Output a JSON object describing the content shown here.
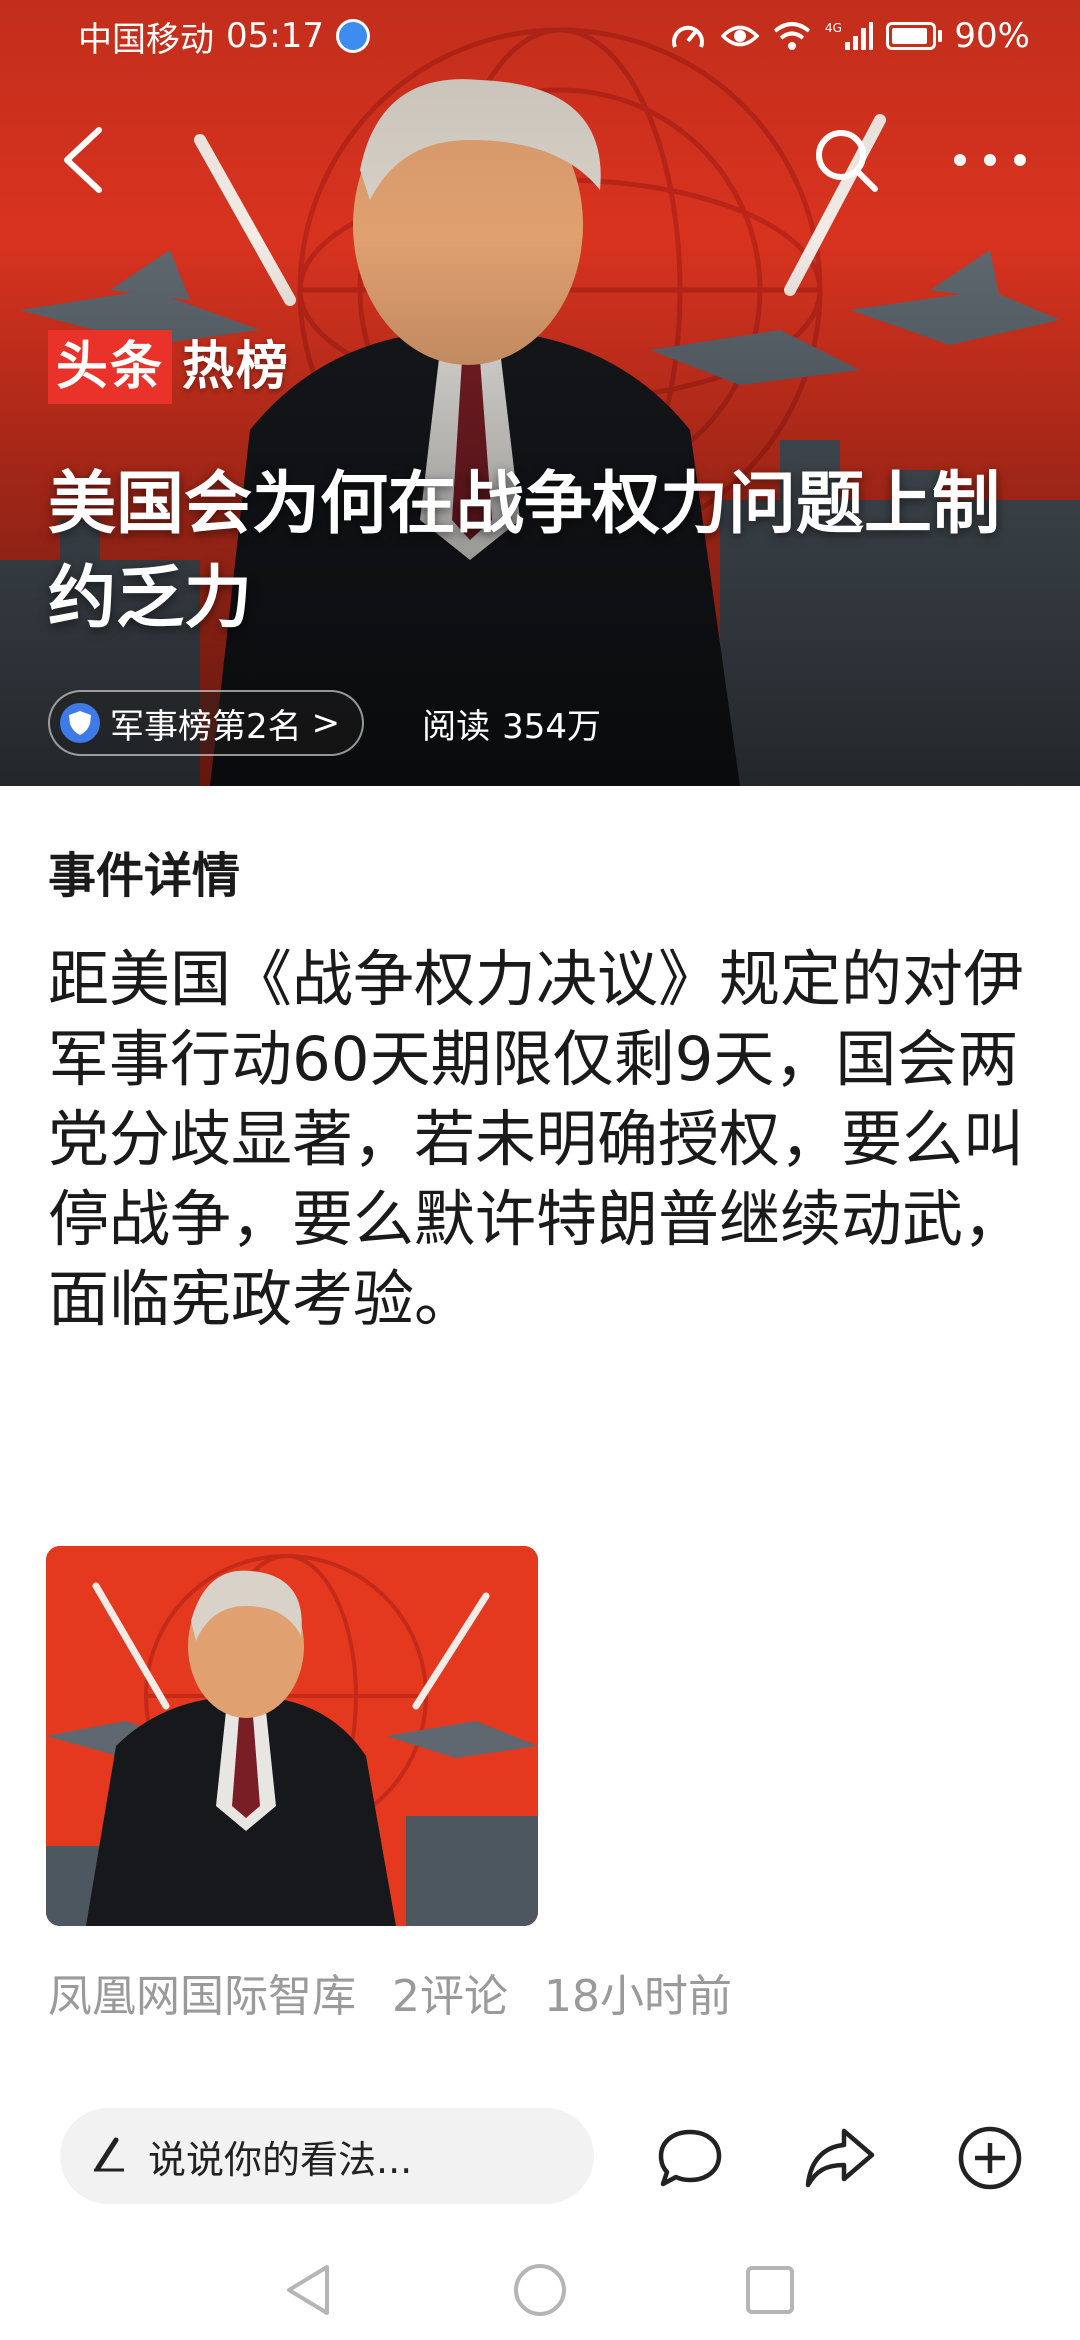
{
  "status_bar": {
    "carrier": "中国移动",
    "time": "05:17",
    "network": "4G",
    "battery_percent": "90%",
    "battery_level": 0.9,
    "icons": [
      "speed-icon",
      "eye-icon",
      "wifi-icon",
      "signal-icon",
      "battery-icon"
    ]
  },
  "nav": {
    "icons": [
      "back-arrow-icon",
      "search-icon",
      "more-icon"
    ]
  },
  "hero": {
    "brand_part1": "头条",
    "brand_part2": "热榜",
    "title": "美国会为何在战争权力问题上制约乏力",
    "rank_label": "军事榜第2名",
    "rank_chevron": ">",
    "read_label": "阅读",
    "read_count": "354万",
    "accent_color": "#d8331f"
  },
  "article": {
    "section_heading": "事件详情",
    "body": "距美国《战争权力决议》规定的对伊军事行动60天期限仅剩9天，国会两党分歧显著，若未明确授权，要么叫停战争，要么默许特朗普继续动武，面临宪政考验。",
    "source": "凤凰网国际智库",
    "comments": "2评论",
    "time_ago": "18小时前"
  },
  "action_bar": {
    "comment_placeholder": "说说你的看法...",
    "icons": [
      "pen-icon",
      "comment-icon",
      "share-icon",
      "add-icon"
    ]
  },
  "system_nav": {
    "icons": [
      "back-triangle-icon",
      "home-circle-icon",
      "recents-square-icon"
    ]
  }
}
